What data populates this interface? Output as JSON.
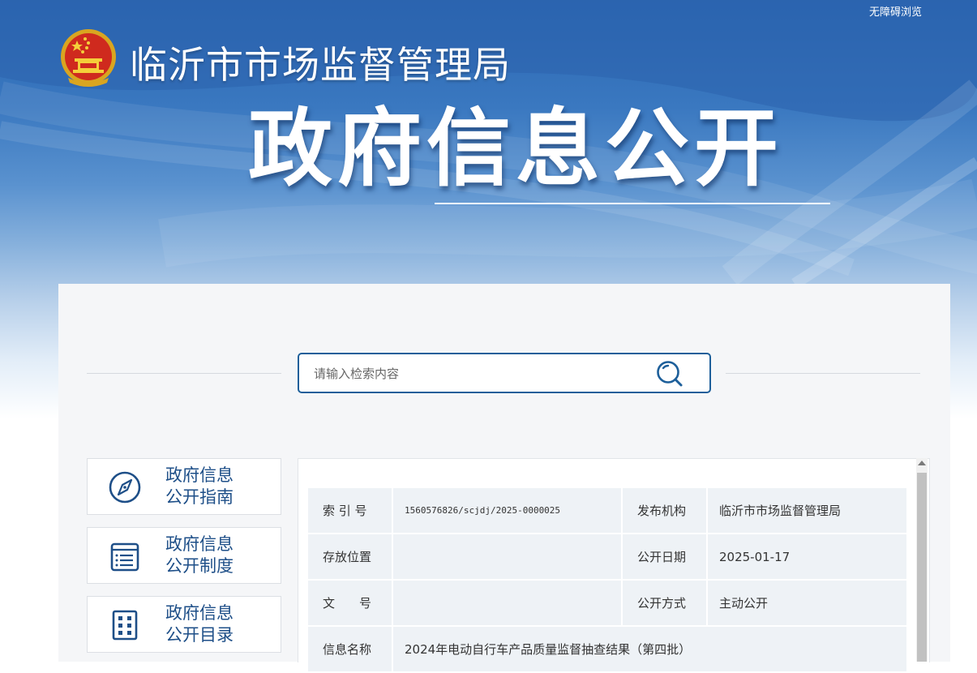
{
  "header": {
    "accessibility_link": "无障碍浏览",
    "site_title": "临沂市市场监督管理局",
    "hero_title": "政府信息公开"
  },
  "search": {
    "placeholder": "请输入检索内容",
    "icon": "search-icon"
  },
  "sidebar": {
    "items": [
      {
        "line1": "政府信息",
        "line2": "公开指南",
        "icon": "compass-icon"
      },
      {
        "line1": "政府信息",
        "line2": "公开制度",
        "icon": "document-list-icon"
      },
      {
        "line1": "政府信息",
        "line2": "公开目录",
        "icon": "catalog-grid-icon"
      }
    ]
  },
  "meta": {
    "index_label": "索 引 号",
    "index_value": "1560576826/scjdj/2025-0000025",
    "publisher_label": "发布机构",
    "publisher_value": "临沂市市场监督管理局",
    "location_label": "存放位置",
    "location_value": "",
    "date_label": "公开日期",
    "date_value": "2025-01-17",
    "docno_label": "文　　号",
    "docno_value": "",
    "method_label": "公开方式",
    "method_value": "主动公开",
    "title_label": "信息名称",
    "title_value": "2024年电动自行车产品质量监督抽查结果（第四批）"
  },
  "colors": {
    "banner_blue": "#2a66b2",
    "accent_navy": "#1e4f88",
    "search_border": "#1d5f9a"
  }
}
